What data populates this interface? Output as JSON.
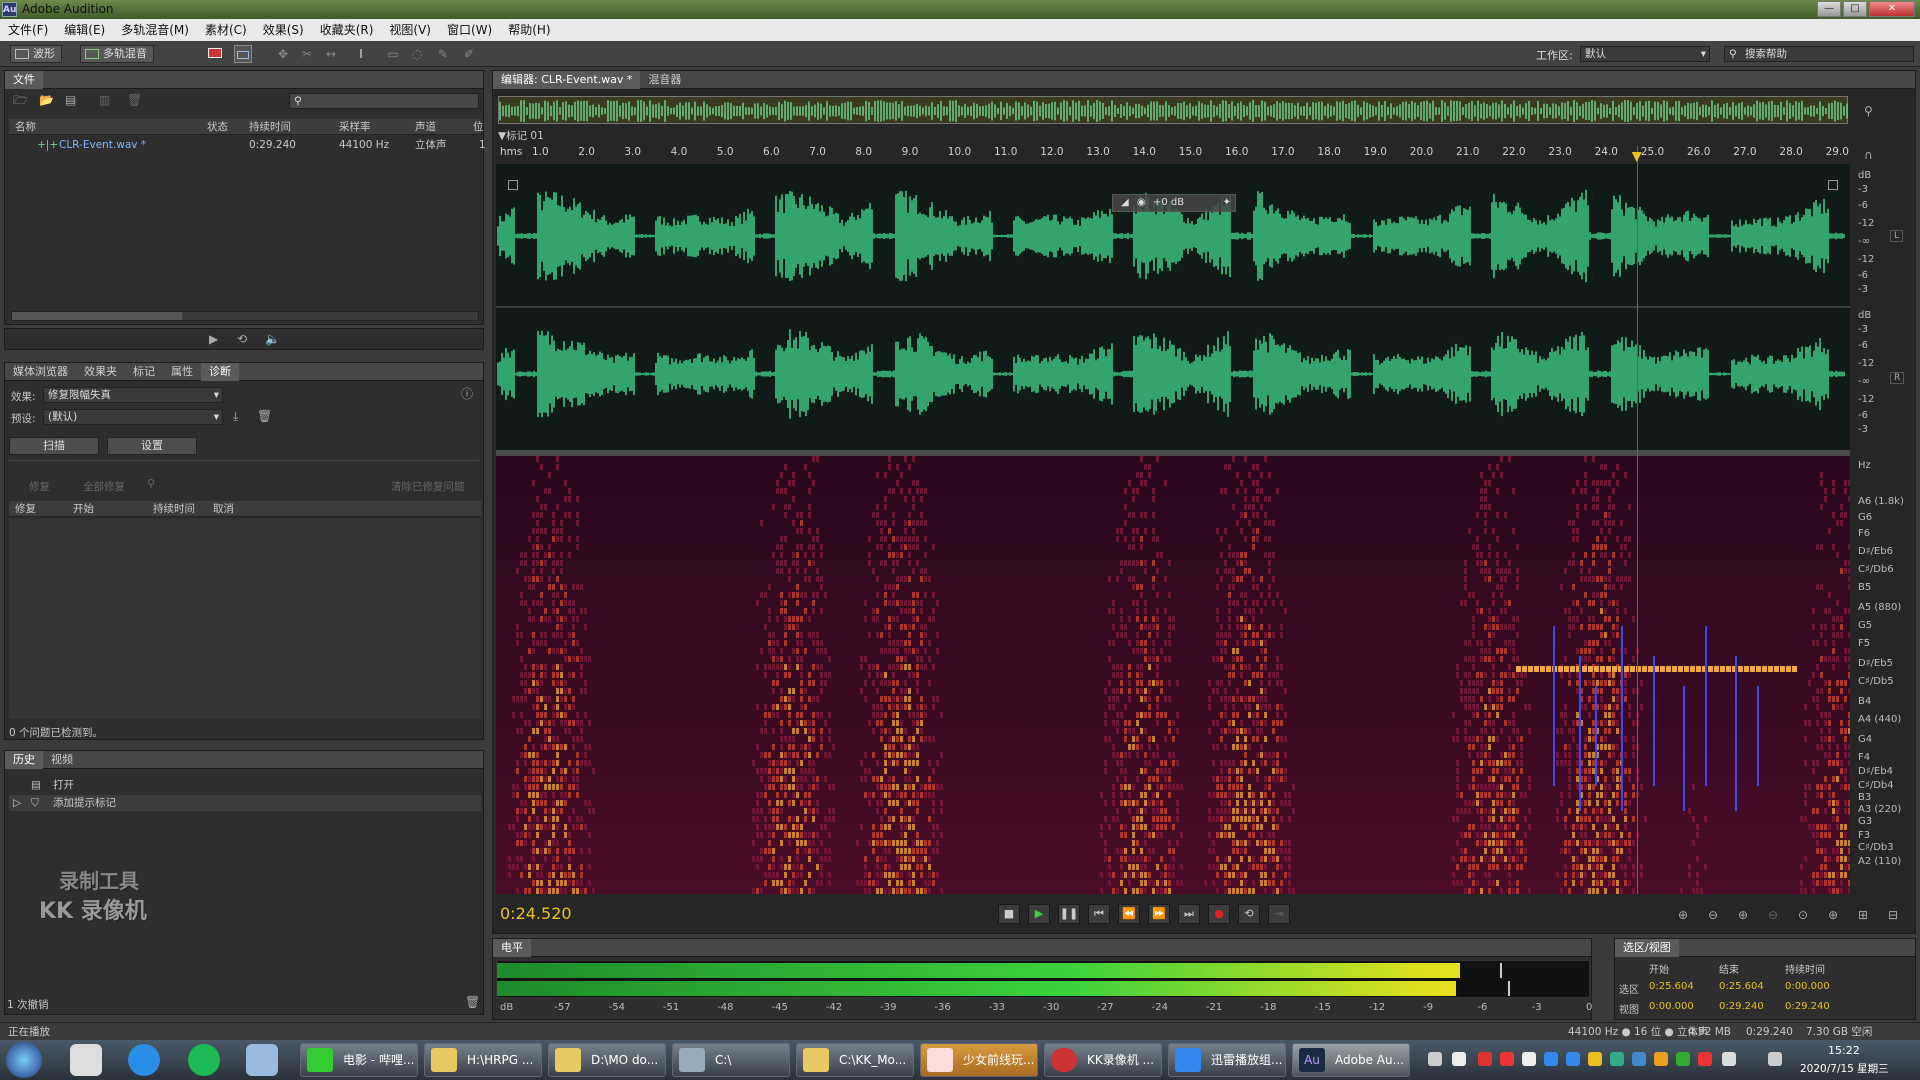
{
  "window": {
    "title": "Adobe Audition",
    "app_icon_label": "Au"
  },
  "menu": [
    "文件(F)",
    "编辑(E)",
    "多轨混音(M)",
    "素材(C)",
    "效果(S)",
    "收藏夹(R)",
    "视图(V)",
    "窗口(W)",
    "帮助(H)"
  ],
  "toolbar": {
    "waveform_label": "波形",
    "multitrack_label": "多轨混音",
    "workspace_label": "工作区:",
    "workspace_value": "默认",
    "search_placeholder": "搜索帮助"
  },
  "files_panel": {
    "tab": "文件",
    "columns": [
      "名称",
      "状态",
      "持续时间",
      "采样率",
      "声道",
      "位"
    ],
    "rows": [
      {
        "name": "CLR-Event.wav *",
        "duration": "0:29.240",
        "rate": "44100 Hz",
        "channels": "立体声",
        "bits": "1"
      }
    ]
  },
  "diag_panel": {
    "tabs": [
      "媒体浏览器",
      "效果夹",
      "标记",
      "属性",
      "诊断"
    ],
    "effect_label": "效果:",
    "effect_value": "修复限幅失真",
    "preset_label": "预设:",
    "preset_value": "(默认)",
    "scan_button": "扫描",
    "settings_button": "设置",
    "repair_button": "修复",
    "repair_all_button": "全部修复",
    "clear_button": "清除已修复问题",
    "columns": [
      "修复",
      "开始",
      "持续时间",
      "取消"
    ],
    "status": "0 个问题已检测到。"
  },
  "history_panel": {
    "tabs": [
      "历史",
      "视频"
    ],
    "items": [
      "打开",
      "添加提示标记"
    ],
    "undo_count": "1 次撤销",
    "watermark_line1": "录制工具",
    "watermark_line2": "KK 录像机"
  },
  "editor": {
    "tab": "编辑器: CLR-Event.wav *",
    "tab2": "混音器",
    "marker": "标记 01",
    "ruler_unit": "hms",
    "ruler_ticks": [
      "1.0",
      "2.0",
      "3.0",
      "4.0",
      "5.0",
      "6.0",
      "7.0",
      "8.0",
      "9.0",
      "10.0",
      "11.0",
      "12.0",
      "13.0",
      "14.0",
      "15.0",
      "16.0",
      "17.0",
      "18.0",
      "19.0",
      "20.0",
      "21.0",
      "22.0",
      "23.0",
      "24.0",
      "25.0",
      "26.0",
      "27.0",
      "28.0",
      "29.0"
    ],
    "gain_hud": "+0 dB",
    "db_labels": [
      "dB",
      "-3",
      "-6",
      "-12",
      "-∞",
      "-12",
      "-6",
      "-3"
    ],
    "channel_left": "L",
    "channel_right": "R",
    "hz_labels": [
      "Hz",
      "A6 (1.8k)",
      "G6",
      "F6",
      "D♯/Eb6",
      "C♯/Db6",
      "B5",
      "A5 (880)",
      "G5",
      "F5",
      "D♯/Eb5",
      "C♯/Db5",
      "B4",
      "A4 (440)",
      "G4",
      "F4",
      "D♯/Eb4",
      "C♯/Db4",
      "B3",
      "A3 (220)",
      "G3",
      "F3",
      "C♯/Db3",
      "A2 (110)"
    ],
    "current_time": "0:24.520",
    "playhead_fraction": 0.8425,
    "waveform_color": "#3fd28a"
  },
  "level_panel": {
    "tab": "电平",
    "ticks": [
      "dB",
      "-57",
      "-54",
      "-51",
      "-48",
      "-45",
      "-42",
      "-39",
      "-36",
      "-33",
      "-30",
      "-27",
      "-24",
      "-21",
      "-18",
      "-15",
      "-12",
      "-9",
      "-6",
      "-3",
      "0"
    ],
    "level_fraction": 0.88
  },
  "selection_panel": {
    "tab": "选区/视图",
    "headers": [
      "开始",
      "结束",
      "持续时间"
    ],
    "rows": [
      {
        "label": "选区",
        "start": "0:25.604",
        "end": "0:25.604",
        "duration": "0:00.000"
      },
      {
        "label": "视图",
        "start": "0:00.000",
        "end": "0:29.240",
        "duration": "0:29.240"
      }
    ]
  },
  "statusbar": {
    "left": "正在播放",
    "info": "44100 Hz ● 16 位 ● 立体声",
    "size": "4.92 MB",
    "duration": "0:29.240",
    "free": "7.30 GB 空闲"
  },
  "taskbar": {
    "items": [
      "电影 - 哔哩...",
      "H:\\HRPG ...",
      "D:\\MO do...",
      "C:\\",
      "C:\\KK_Mo...",
      "少女前线玩...",
      "KK录像机 ...",
      "迅雷播放组...",
      "Adobe Au..."
    ],
    "time": "15:22",
    "date": "2020/7/15 星期三"
  }
}
